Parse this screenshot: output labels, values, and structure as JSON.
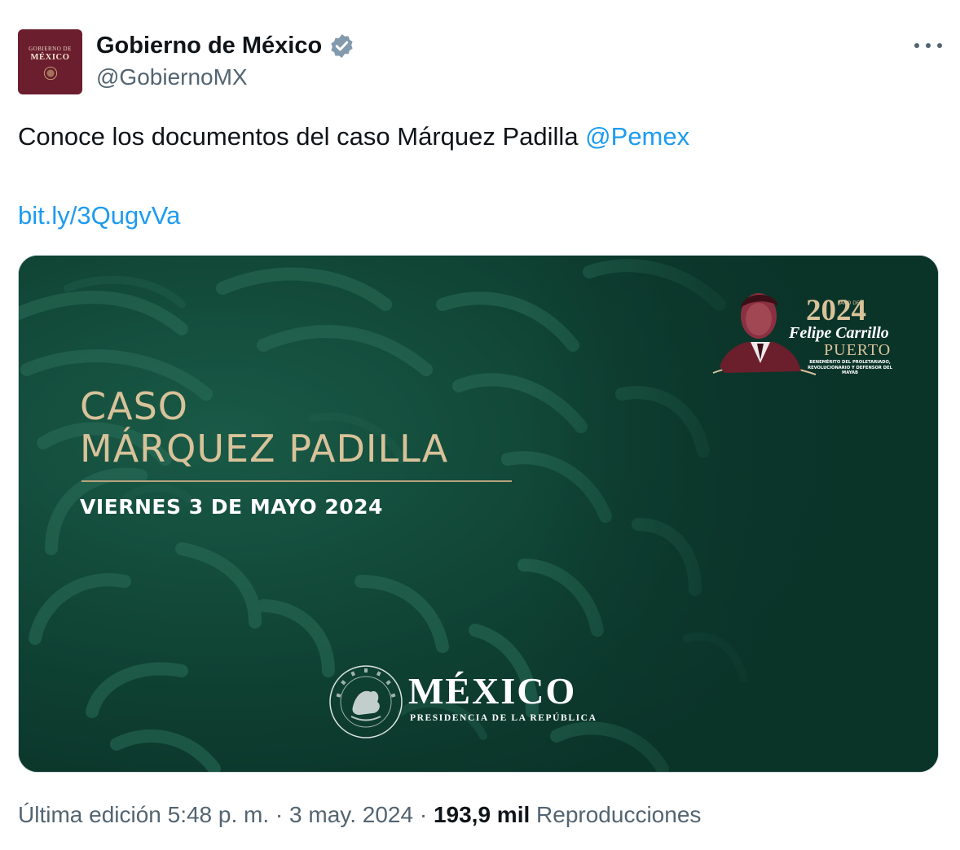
{
  "header": {
    "display_name": "Gobierno de México",
    "handle": "@GobiernoMX",
    "avatar_line1": "GOBIERNO DE",
    "avatar_line2": "MÉXICO"
  },
  "tweet": {
    "text": "Conoce los documentos del caso Márquez Padilla ",
    "mention": "@Pemex",
    "link": "bit.ly/3QugvVa"
  },
  "card": {
    "title_line1": "CASO",
    "title_line2": "MÁRQUEZ PADILLA",
    "date": "VIERNES 3 DE MAYO 2024",
    "logo_title": "MÉXICO",
    "logo_subtitle": "PRESIDENCIA DE LA REPÚBLICA",
    "badge_year": "2024",
    "badge_year_label": "AÑO DE",
    "badge_name": "Felipe Carrillo",
    "badge_puerto": "PUERTO",
    "badge_small": "BENEMÉRITO DEL PROLETARIADO, REVOLUCIONARIO Y DEFENSOR DEL MAYAB"
  },
  "meta": {
    "edited": "Última edición 5:48 p. m.",
    "sep1": " · ",
    "date": "3 may. 2024",
    "sep2": " · ",
    "views_count": "193,9 mil",
    "views_label": " Reproducciones"
  },
  "colors": {
    "link": "#1d9bf0",
    "card_bg": "#0c3a2e",
    "gold": "#d8c29a",
    "avatar_bg": "#6b1e2e"
  },
  "icons": [
    "verified-badge-icon",
    "more-options-icon",
    "eagle-seal-icon"
  ]
}
